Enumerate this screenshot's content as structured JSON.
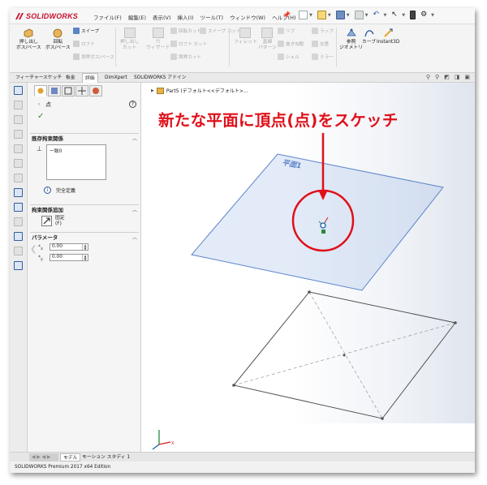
{
  "app": {
    "logo_text": "SOLIDWORKS",
    "menu": [
      "ファイル(F)",
      "編集(E)",
      "表示(V)",
      "挿入(I)",
      "ツール(T)",
      "ウィンドウ(W)",
      "ヘルプ(H)"
    ]
  },
  "command_manager": {
    "extrude_label_1": "押し出し",
    "extrude_label_2": "ボス/ベース",
    "revolve_label_1": "回転",
    "revolve_label_2": "ボス/ベース",
    "sweep": "スイープ",
    "loft": "ロフト",
    "boundary_boss": "境界ボス/ベース",
    "extruded_cut_1": "押し出し",
    "extruded_cut_2": "カット",
    "hole_wizard_1": "穴",
    "hole_wizard_2": "ウィザード",
    "revolved_cut": "回転カット",
    "swept_cut": "スイープ カット",
    "lofted_cut": "ロフト カット",
    "boundary_cut": "境界カット",
    "fillet": "フィレット",
    "linear_pattern_1": "直線",
    "linear_pattern_2": "パターン",
    "rib": "リブ",
    "draft": "抜き勾配",
    "shell": "シェル",
    "wrap": "ラップ",
    "intersect": "交差",
    "mirror": "ミラー",
    "ref_geometry_1": "参照",
    "ref_geometry_2": "ジオメトリ",
    "curves": "カーブ",
    "instant3d": "Instant3D"
  },
  "tabs": [
    "フィーチャー",
    "スケッチ",
    "板金",
    "評価",
    "DimXpert",
    "SOLIDWORKS アドイン"
  ],
  "active_tab": "評価",
  "property_manager": {
    "title": "点",
    "existing_relations_header": "既存拘束関係",
    "existing_relations_item": "一致0",
    "status": "完全定義",
    "add_relations_header": "拘束関係追加",
    "fix_label_1": "固定",
    "fix_label_2": "(F)",
    "parameters_header": "パラメータ",
    "param_x_label": "x",
    "param_x_value": "0.00",
    "param_y_label": "y",
    "param_y_value": "0.00"
  },
  "graphics": {
    "tree_item": "Part5 (デフォルト<<デフォルト>...",
    "annotation": "新たな平面に頂点(点)をスケッチ",
    "plane_label": "平面1"
  },
  "bottom_tabs": [
    "モデル",
    "モーション スタディ 1"
  ],
  "status_bar": "SOLIDWORKS Premium 2017 x64 Edition",
  "colors": {
    "annotation_red": "#e0101a",
    "plane_blue": "#5b84c9",
    "brand_red": "#c8102e"
  }
}
